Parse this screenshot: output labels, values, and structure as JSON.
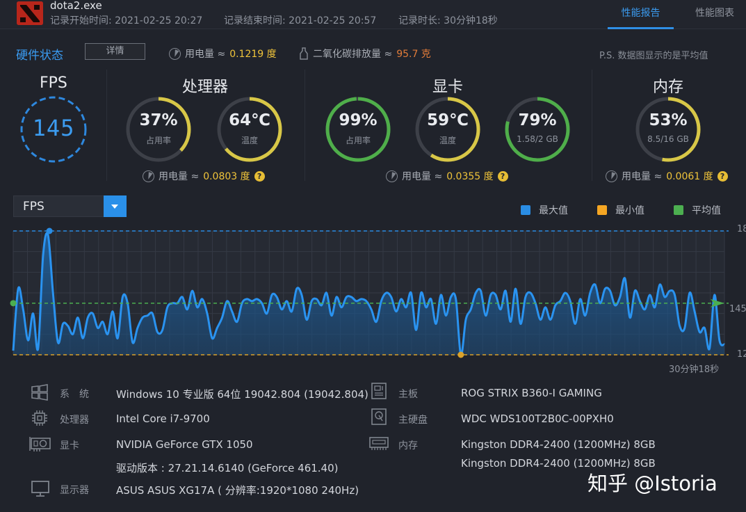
{
  "header": {
    "app_name": "dota2.exe",
    "record_start": "记录开始时间: 2021-02-25 20:27",
    "record_end": "记录结束时间: 2021-02-25 20:57",
    "record_duration": "记录时长: 30分钟18秒",
    "tabs": [
      {
        "label": "性能报告",
        "active": true
      },
      {
        "label": "性能图表",
        "active": false
      }
    ]
  },
  "status_bar": {
    "title": "硬件状态",
    "detail_button": "详情",
    "power_label": "用电量 ≈",
    "power_value": "0.1219 度",
    "co2_label": "二氧化碳排放量 ≈",
    "co2_value": "95.7 克",
    "note": "P.S. 数据图显示的是平均值"
  },
  "fps_panel": {
    "title": "FPS",
    "value": "145"
  },
  "cpu_panel": {
    "title": "处理器",
    "gauges": [
      {
        "value": "37%",
        "sub": "占用率",
        "fraction": 0.37,
        "color": "#d8c747"
      },
      {
        "value": "64℃",
        "sub": "温度",
        "fraction": 0.64,
        "color": "#d8c747"
      }
    ],
    "power_label": "用电量 ≈",
    "power_value": "0.0803 度",
    "help": "?"
  },
  "gpu_panel": {
    "title": "显卡",
    "gauges": [
      {
        "value": "99%",
        "sub": "占用率",
        "fraction": 0.99,
        "color": "#4fae4a"
      },
      {
        "value": "59℃",
        "sub": "温度",
        "fraction": 0.59,
        "color": "#d8c747"
      },
      {
        "value": "79%",
        "sub": "1.58/2 GB",
        "fraction": 0.79,
        "color": "#4fae4a"
      }
    ],
    "power_label": "用电量 ≈",
    "power_value": "0.0355 度",
    "help": "?"
  },
  "mem_panel": {
    "title": "内存",
    "gauges": [
      {
        "value": "53%",
        "sub": "8.5/16 GB",
        "fraction": 0.53,
        "color": "#d8c747"
      }
    ],
    "power_label": "用电量 ≈",
    "power_value": "0.0061 度",
    "help": "?"
  },
  "chart_controls": {
    "metric_select": "FPS",
    "legend": [
      {
        "label": "最大值",
        "color": "#2a8de4"
      },
      {
        "label": "最小值",
        "color": "#f5a623"
      },
      {
        "label": "平均值",
        "color": "#4caf50"
      }
    ]
  },
  "chart_data": {
    "type": "area",
    "title": "",
    "xlabel": "30分钟18秒",
    "ylabel": "",
    "ylim": [
      120,
      180
    ],
    "max_label": "18",
    "avg_label": "145",
    "min_label": "12",
    "max_value": 180,
    "avg_value": 145,
    "min_value": 120,
    "values": [
      122,
      152,
      142,
      127,
      140,
      123,
      168,
      178,
      150,
      126,
      135,
      134,
      130,
      138,
      128,
      138,
      140,
      133,
      136,
      130,
      141,
      128,
      148,
      145,
      126,
      133,
      138,
      139,
      140,
      131,
      132,
      143,
      145,
      145,
      148,
      142,
      151,
      143,
      147,
      140,
      128,
      133,
      138,
      146,
      141,
      136,
      145,
      147,
      146,
      147,
      145,
      140,
      149,
      148,
      142,
      146,
      141,
      152,
      149,
      137,
      146,
      147,
      144,
      150,
      139,
      148,
      143,
      148,
      148,
      146,
      147,
      146,
      142,
      136,
      146,
      150,
      148,
      141,
      147,
      143,
      150,
      132,
      150,
      143,
      147,
      135,
      149,
      139,
      148,
      147,
      120,
      137,
      142,
      150,
      151,
      139,
      149,
      149,
      142,
      151,
      136,
      152,
      135,
      148,
      150,
      145,
      137,
      143,
      137,
      144,
      146,
      150,
      146,
      135,
      147,
      139,
      150,
      154,
      145,
      152,
      151,
      144,
      148,
      157,
      138,
      151,
      146,
      142,
      149,
      143,
      154,
      148,
      151,
      149,
      134,
      133,
      150,
      141,
      131,
      133,
      123,
      149,
      127,
      125
    ]
  },
  "system_info": {
    "left": [
      {
        "icon": "windows-icon",
        "label": "系　统",
        "value": "Windows 10 专业版 64位   19042.804 (19042.804)"
      },
      {
        "icon": "cpu-icon",
        "label": "处理器",
        "value": "Intel Core i7-9700"
      },
      {
        "icon": "gpu-icon",
        "label": "显卡",
        "value": "NVIDIA GeForce GTX 1050",
        "value2": "驱动版本 : 27.21.14.6140 (GeForce 461.40)"
      },
      {
        "icon": "monitor-icon",
        "label": "显示器",
        "value": "ASUS ASUS XG17A ( 分辨率:1920*1080 240Hz)"
      }
    ],
    "right": [
      {
        "icon": "motherboard-icon",
        "label": "主板",
        "value": "ROG STRIX B360-I GAMING"
      },
      {
        "icon": "harddisk-icon",
        "label": "主硬盘",
        "value": "WDC WDS100T2B0C-00PXH0"
      },
      {
        "icon": "memory-icon",
        "label": "内存",
        "value": "Kingston DDR4-2400 (1200MHz) 8GB",
        "value2": "Kingston DDR4-2400 (1200MHz) 8GB"
      }
    ]
  },
  "watermark": "知乎 @Istoria"
}
